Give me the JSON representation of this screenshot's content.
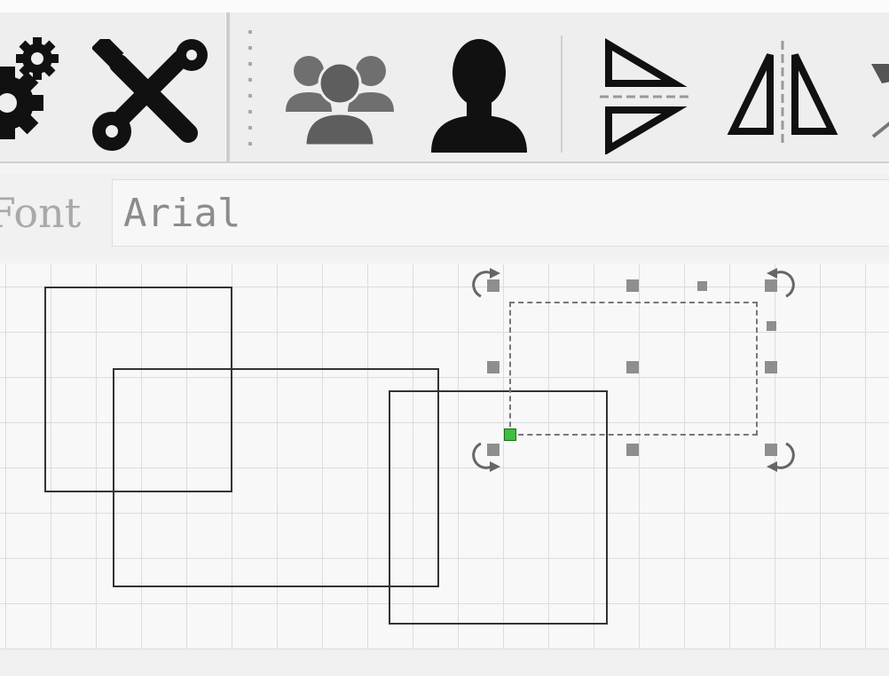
{
  "toolbar": {
    "icons": [
      "gears-icon",
      "wrench-screwdriver-icon",
      "users-group-icon",
      "user-icon",
      "flip-vertical-icon",
      "flip-horizontal-icon",
      "more-tools-icon"
    ]
  },
  "format": {
    "font_label": "Font",
    "font_value": "Arial"
  },
  "canvas": {
    "shapes": [
      "rectangle",
      "rectangle",
      "rectangle",
      "rectangle"
    ],
    "selected_shape": "rectangle",
    "grid": true,
    "colors": {
      "selection_anchor": "#3fbf3f",
      "handles": "#8e8e8e",
      "grid_lines": "#dcdcdc"
    }
  }
}
